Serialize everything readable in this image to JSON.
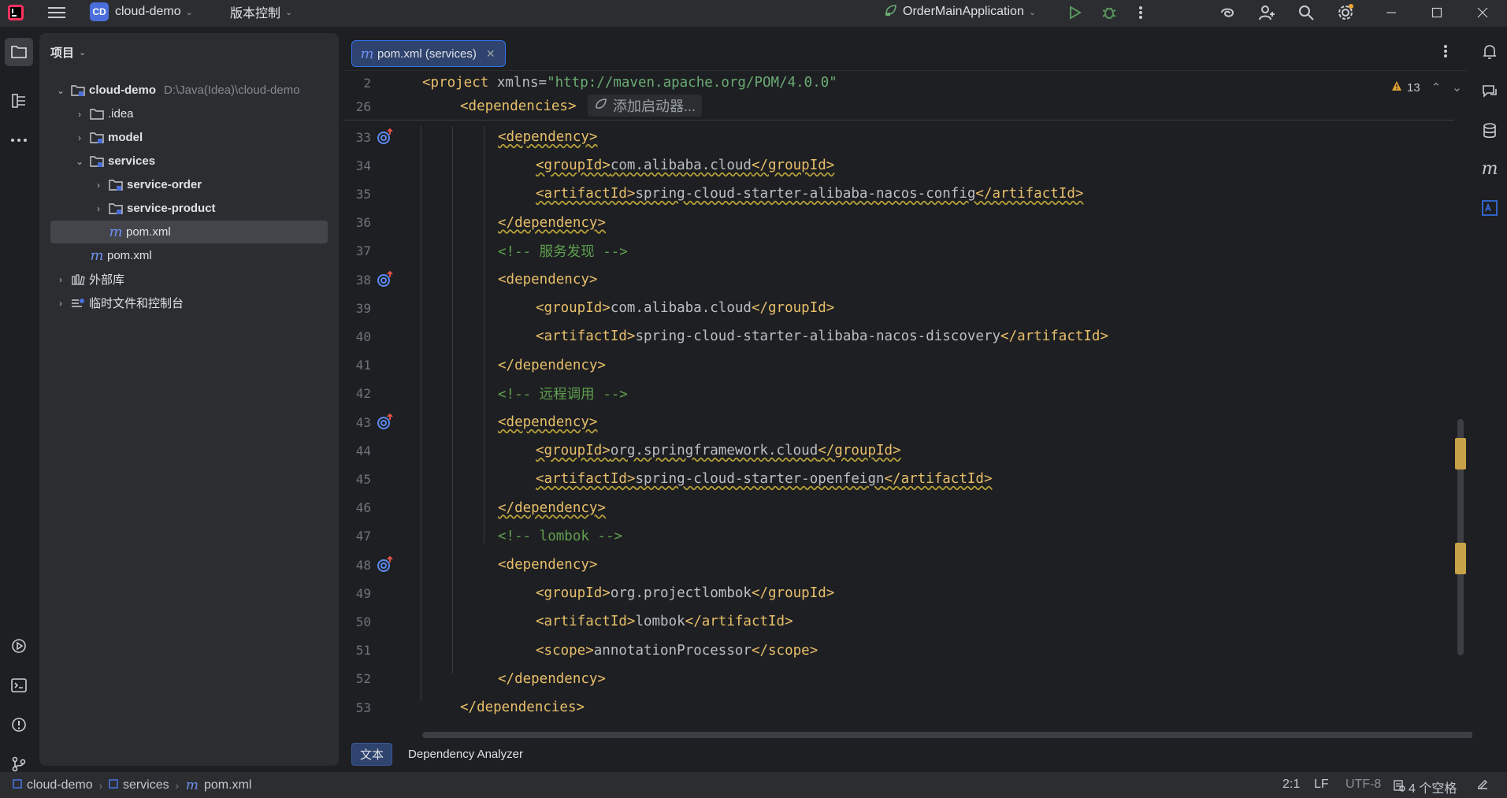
{
  "titlebar": {
    "project_badge": "CD",
    "project_name": "cloud-demo",
    "vcs_menu": "版本控制",
    "run_config": "OrderMainApplication"
  },
  "project_panel": {
    "title": "项目",
    "tree": [
      {
        "label": "cloud-demo",
        "path": "D:\\Java(Idea)\\cloud-demo"
      },
      {
        "label": ".idea"
      },
      {
        "label": "model"
      },
      {
        "label": "services"
      },
      {
        "label": "service-order"
      },
      {
        "label": "service-product"
      },
      {
        "label": "pom.xml"
      },
      {
        "label": "pom.xml"
      },
      {
        "label": "外部库"
      },
      {
        "label": "临时文件和控制台"
      }
    ]
  },
  "editor": {
    "tab_label": "pom.xml (services)",
    "warnings_count": "13",
    "add_starter": "添加启动器...",
    "bottom_tabs": [
      "文本",
      "Dependency Analyzer"
    ],
    "sticky_lines": [
      {
        "num": "2",
        "parts": [
          [
            "tag",
            "<project"
          ],
          [
            "txt",
            " xmlns="
          ],
          [
            "str",
            "\"http://maven.apache.org/POM/4.0.0\""
          ]
        ]
      },
      {
        "num": "26",
        "parts": [
          [
            "tag",
            "<dependencies>"
          ]
        ]
      }
    ],
    "lines": [
      {
        "num": "33",
        "indent": 2,
        "gutter": true,
        "parts": [
          [
            "tagw",
            "<dependency>"
          ]
        ]
      },
      {
        "num": "34",
        "indent": 3,
        "parts": [
          [
            "tagw",
            "<groupId>"
          ],
          [
            "txtw",
            "com.alibaba.cloud"
          ],
          [
            "tagw",
            "</groupId>"
          ]
        ]
      },
      {
        "num": "35",
        "indent": 3,
        "parts": [
          [
            "tagw",
            "<artifactId>"
          ],
          [
            "txtw",
            "spring-cloud-starter-alibaba-nacos-config"
          ],
          [
            "tagw",
            "</artifactId>"
          ]
        ]
      },
      {
        "num": "36",
        "indent": 2,
        "parts": [
          [
            "tagw",
            "</dependency>"
          ]
        ]
      },
      {
        "num": "37",
        "indent": 2,
        "parts": [
          [
            "cmt",
            "<!-- 服务发现 -->"
          ]
        ]
      },
      {
        "num": "38",
        "indent": 2,
        "gutter": true,
        "parts": [
          [
            "tag",
            "<dependency>"
          ]
        ]
      },
      {
        "num": "39",
        "indent": 3,
        "parts": [
          [
            "tag",
            "<groupId>"
          ],
          [
            "txt",
            "com.alibaba.cloud"
          ],
          [
            "tag",
            "</groupId>"
          ]
        ]
      },
      {
        "num": "40",
        "indent": 3,
        "parts": [
          [
            "tag",
            "<artifactId>"
          ],
          [
            "txt",
            "spring-cloud-starter-alibaba-nacos-discovery"
          ],
          [
            "tag",
            "</artifactId>"
          ]
        ]
      },
      {
        "num": "41",
        "indent": 2,
        "parts": [
          [
            "tag",
            "</dependency>"
          ]
        ]
      },
      {
        "num": "42",
        "indent": 2,
        "parts": [
          [
            "cmt",
            "<!-- 远程调用 -->"
          ]
        ]
      },
      {
        "num": "43",
        "indent": 2,
        "gutter": true,
        "parts": [
          [
            "tagw",
            "<dependency>"
          ]
        ]
      },
      {
        "num": "44",
        "indent": 3,
        "parts": [
          [
            "tagw",
            "<groupId>"
          ],
          [
            "txtw",
            "org.springframework.cloud"
          ],
          [
            "tagw",
            "</groupId>"
          ]
        ]
      },
      {
        "num": "45",
        "indent": 3,
        "parts": [
          [
            "tagw",
            "<artifactId>"
          ],
          [
            "txtw",
            "spring-cloud-starter-openfeign"
          ],
          [
            "tagw",
            "</artifactId>"
          ]
        ]
      },
      {
        "num": "46",
        "indent": 2,
        "parts": [
          [
            "tagw",
            "</dependency>"
          ]
        ]
      },
      {
        "num": "47",
        "indent": 2,
        "parts": [
          [
            "cmt",
            "<!-- lombok -->"
          ]
        ]
      },
      {
        "num": "48",
        "indent": 2,
        "gutter": true,
        "parts": [
          [
            "tag",
            "<dependency>"
          ]
        ]
      },
      {
        "num": "49",
        "indent": 3,
        "parts": [
          [
            "tag",
            "<groupId>"
          ],
          [
            "txt",
            "org.projectlombok"
          ],
          [
            "tag",
            "</groupId>"
          ]
        ]
      },
      {
        "num": "50",
        "indent": 3,
        "parts": [
          [
            "tag",
            "<artifactId>"
          ],
          [
            "txt",
            "lombok"
          ],
          [
            "tag",
            "</artifactId>"
          ]
        ]
      },
      {
        "num": "51",
        "indent": 3,
        "parts": [
          [
            "tag",
            "<scope>"
          ],
          [
            "txt",
            "annotationProcessor"
          ],
          [
            "tag",
            "</scope>"
          ]
        ]
      },
      {
        "num": "52",
        "indent": 2,
        "parts": [
          [
            "tag",
            "</dependency>"
          ]
        ]
      },
      {
        "num": "53",
        "indent": 1,
        "parts": [
          [
            "tag",
            "</dependencies>"
          ]
        ]
      }
    ]
  },
  "statusbar": {
    "breadcrumb": [
      "cloud-demo",
      "services",
      "pom.xml"
    ],
    "position": "2:1",
    "line_sep": "LF",
    "encoding": "UTF-8",
    "indent": "4 个空格"
  },
  "colors": {
    "accent": "#3574f0",
    "tag": "#e8bf6a",
    "string": "#6aab73",
    "comment": "#5f9f4e",
    "warning": "#c7a248"
  }
}
